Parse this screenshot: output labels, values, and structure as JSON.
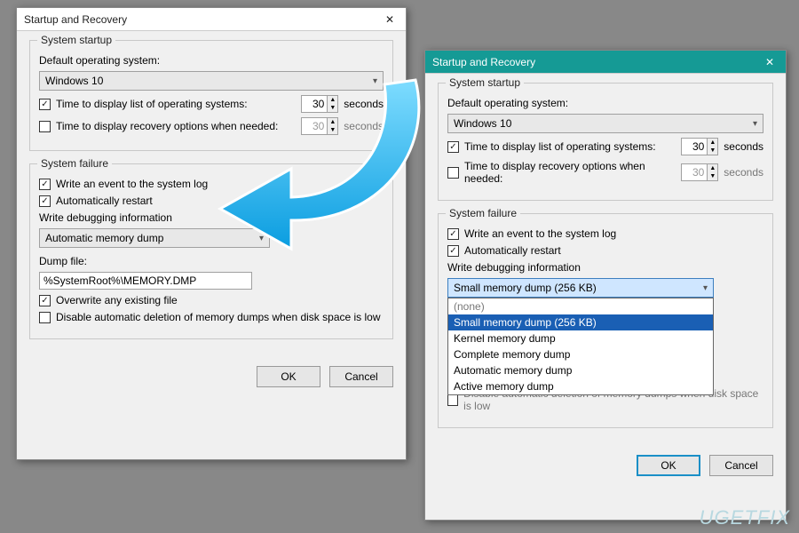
{
  "dialog_title": "Startup and Recovery",
  "close_glyph": "✕",
  "groups": {
    "startup": "System startup",
    "failure": "System failure"
  },
  "labels": {
    "default_os": "Default operating system:",
    "time_os_list": "Time to display list of operating systems:",
    "time_recovery": "Time to display recovery options when needed:",
    "seconds": "seconds",
    "write_event": "Write an event to the system log",
    "auto_restart": "Automatically restart",
    "write_debug": "Write debugging information",
    "dump_file": "Dump file:",
    "overwrite": "Overwrite any existing file",
    "disable_delete": "Disable automatic deletion of memory dumps when disk space is low",
    "ok": "OK",
    "cancel": "Cancel"
  },
  "left": {
    "os_value": "Windows 10",
    "time_os_checked": true,
    "time_os_value": "30",
    "time_rec_checked": false,
    "time_rec_value": "30",
    "write_event_checked": true,
    "auto_restart_checked": true,
    "debug_value": "Automatic memory dump",
    "dump_path": "%SystemRoot%\\MEMORY.DMP",
    "overwrite_checked": true,
    "disable_delete_checked": false
  },
  "right": {
    "os_value": "Windows 10",
    "time_os_checked": true,
    "time_os_value": "30",
    "time_rec_checked": false,
    "time_rec_value": "30",
    "write_event_checked": true,
    "auto_restart_checked": true,
    "debug_value": "Small memory dump (256 KB)",
    "options": [
      "(none)",
      "Small memory dump (256 KB)",
      "Kernel memory dump",
      "Complete memory dump",
      "Automatic memory dump",
      "Active memory dump"
    ],
    "selected_option": "Small memory dump (256 KB)",
    "disable_delete_checked": false
  },
  "watermark": "UGETFIX"
}
